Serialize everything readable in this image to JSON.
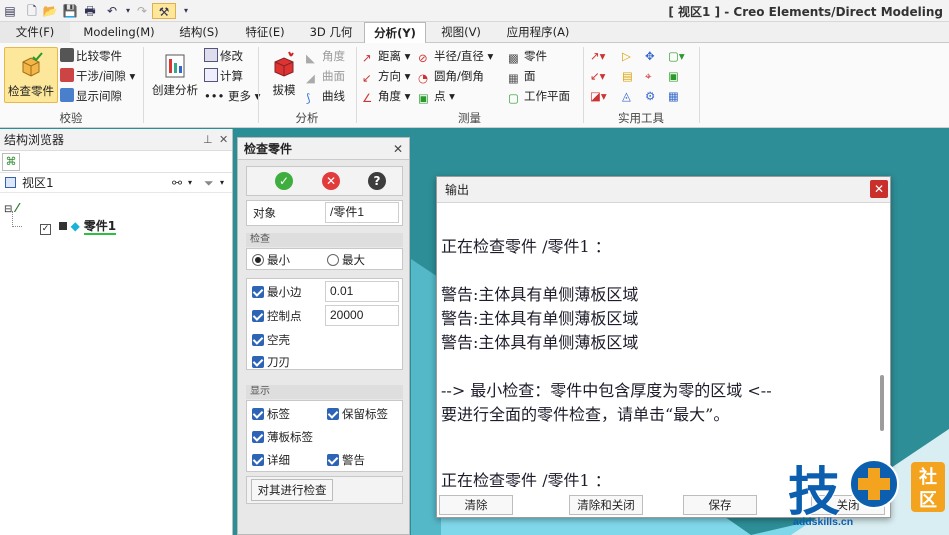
{
  "app_title": "[ 视区1 ] - Creo Elements/Direct Modeling",
  "tabs": [
    {
      "label": "文件(F)",
      "active": false
    },
    {
      "label": "Modeling(M)",
      "active": false
    },
    {
      "label": "结构(S)",
      "active": false
    },
    {
      "label": "特征(E)",
      "active": false
    },
    {
      "label": "3D 几何",
      "active": false
    },
    {
      "label": "分析(Y)",
      "active": true
    },
    {
      "label": "视图(V)",
      "active": false
    },
    {
      "label": "应用程序(A)",
      "active": false
    }
  ],
  "ribbon": {
    "verify": {
      "label": "校验",
      "check_part": "检查零件",
      "compare_part": "比较零件",
      "interference": "干涉/间隙",
      "show_clearance": "显示间隙"
    },
    "analysis": {
      "label": "分析",
      "create_analysis": "创建分析",
      "modify": "修改",
      "calculate": "计算",
      "more": "更多",
      "draft": "拔模",
      "angle": "角度",
      "surface": "曲面",
      "curve": "曲线"
    },
    "measure": {
      "label": "测量",
      "distance": "距离",
      "direction": "方向",
      "angle": "角度",
      "radius_diameter": "半径/直径",
      "fillet_chamfer": "圆角/倒角",
      "point": "点",
      "part": "零件",
      "face": "面",
      "workplane": "工作平面"
    },
    "utilities": {
      "label": "实用工具"
    }
  },
  "browser": {
    "title": "结构浏览器",
    "viewport_label": "视区1",
    "part_label": "零件1"
  },
  "check_panel": {
    "title": "检查零件",
    "object_label": "对象",
    "object_value": "/零件1",
    "check_section": "检查",
    "min_label": "最小",
    "max_label": "最大",
    "min_mode_selected": "最小",
    "min_edge_label": "最小边",
    "min_edge_value": "0.01",
    "control_points_label": "控制点",
    "control_points_value": "20000",
    "hollow_label": "空壳",
    "blade_label": "刀刃",
    "display_section": "显示",
    "tag_label": "标签",
    "keep_tag_label": "保留标签",
    "thin_tag_label": "薄板标签",
    "detail_label": "详细",
    "warning_label": "警告",
    "run_button": "对其进行检查"
  },
  "output": {
    "title": "输出",
    "lines": [
      "正在检查零件 /零件1 ：",
      "",
      "警告:主体具有单侧薄板区域",
      "警告:主体具有单侧薄板区域",
      "警告:主体具有单侧薄板区域",
      "",
      "--> 最小检查：零件中包含厚度为零的区域 <--",
      "要进行全面的零件检查，请单击“最大”。",
      "",
      "",
      "正在检查零件 /零件1 ："
    ],
    "clear_button": "清除",
    "clear_close_button": "清除和关闭",
    "save_button": "保存",
    "close_button": "关闭"
  },
  "watermark": {
    "char": "技",
    "badge_top": "社",
    "badge_bottom": "区",
    "site": "addskills.cn"
  },
  "colors": {
    "check_blue": "#2d64b6",
    "ribbon_active": "#fde79a",
    "viewport_teal": "#2d8e97",
    "floor_cyan": "#7fd8ea",
    "close_red": "#c9302c",
    "watermark_blue": "#0b5fae",
    "watermark_orange": "#f3a31d"
  }
}
